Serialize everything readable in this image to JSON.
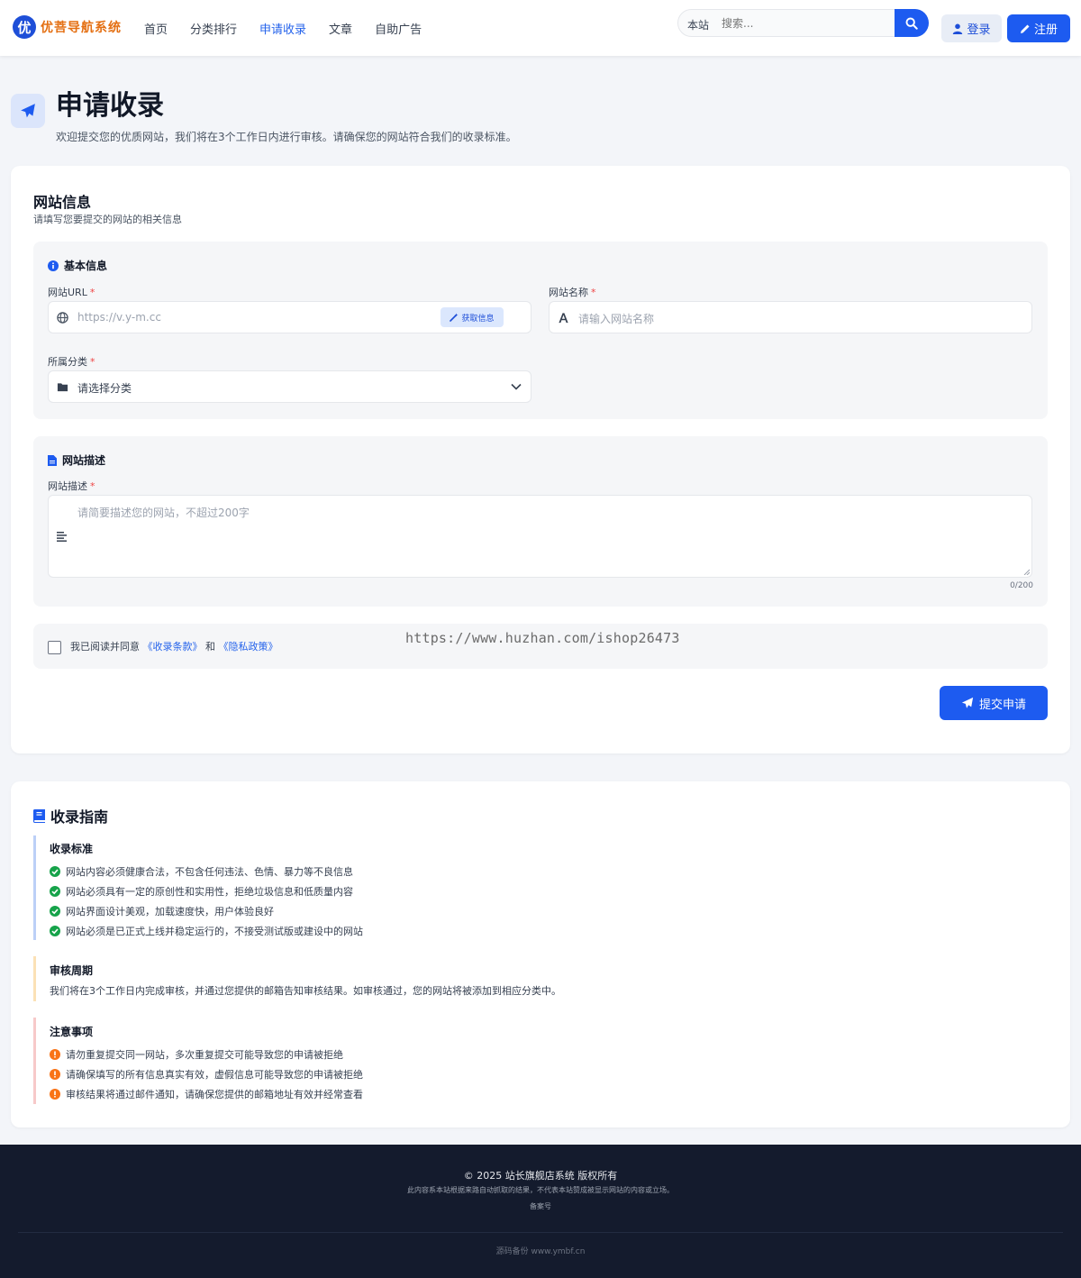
{
  "brand": {
    "badge": "优",
    "name": "优菩导航系统"
  },
  "nav": [
    "首页",
    "分类排行",
    "申请收录",
    "文章",
    "自助广告"
  ],
  "search": {
    "scope": "本站",
    "placeholder": "搜索..."
  },
  "auth": {
    "login": "登录",
    "register": "注册"
  },
  "page": {
    "title": "申请收录",
    "subtitle": "欢迎提交您的优质网站，我们将在3个工作日内进行审核。请确保您的网站符合我们的收录标准。"
  },
  "form": {
    "title": "网站信息",
    "subtitle": "请填写您要提交的网站的相关信息",
    "basic": {
      "title": "基本信息",
      "url_label": "网站URL",
      "url_placeholder": "https://v.y-m.cc",
      "fetch_label": "获取信息",
      "name_label": "网站名称",
      "name_placeholder": "请输入网站名称",
      "category_label": "所属分类",
      "category_value": "请选择分类"
    },
    "description": {
      "title": "网站描述",
      "label": "网站描述",
      "placeholder": "请简要描述您的网站，不超过200字",
      "counter": "0/200"
    },
    "agree": {
      "prefix": "我已阅读并同意",
      "terms": "《收录条款》",
      "and": "和",
      "privacy": "《隐私政策》"
    },
    "watermark": "https://www.huzhan.com/ishop26473",
    "submit": "提交申请",
    "required_mark": "*"
  },
  "guide": {
    "title": "收录指南",
    "standards": {
      "title": "收录标准",
      "items": [
        "网站内容必须健康合法，不包含任何违法、色情、暴力等不良信息",
        "网站必须具有一定的原创性和实用性，拒绝垃圾信息和低质量内容",
        "网站界面设计美观，加载速度快，用户体验良好",
        "网站必须是已正式上线并稳定运行的，不接受测试版或建设中的网站"
      ]
    },
    "cycle": {
      "title": "审核周期",
      "text": "我们将在3个工作日内完成审核，并通过您提供的邮箱告知审核结果。如审核通过，您的网站将被添加到相应分类中。"
    },
    "notes": {
      "title": "注意事项",
      "items": [
        "请勿重复提交同一网站，多次重复提交可能导致您的申请被拒绝",
        "请确保填写的所有信息真实有效，虚假信息可能导致您的申请被拒绝",
        "审核结果将通过邮件通知，请确保您提供的邮箱地址有效并经常查看"
      ]
    }
  },
  "footer": {
    "copyright": "© 2025 站长旗舰店系统 版权所有",
    "notice": "此内容系本站根据来路自动抓取的结果，不代表本站赞成被显示网站的内容或立场。",
    "icp": "备案号",
    "source": "源码备份 www.ymbf.cn"
  },
  "colors": {
    "primary": "#1d5bf0",
    "brand_text": "#e46f12",
    "footer_bg": "#141b2d",
    "success": "#16a34a",
    "warning": "#f97316"
  }
}
